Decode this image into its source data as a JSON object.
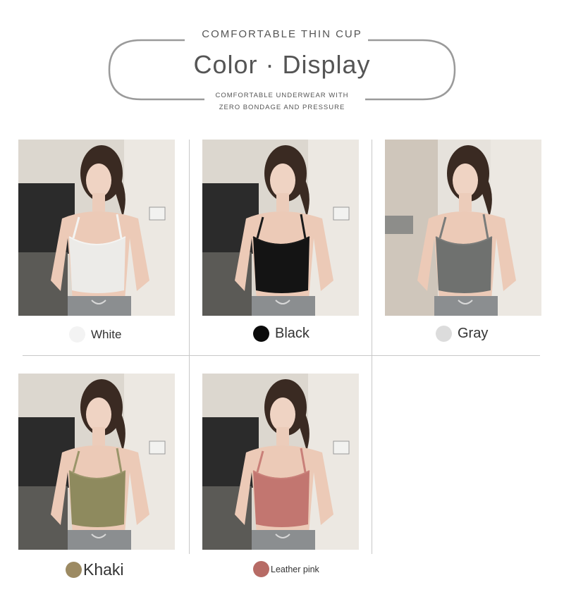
{
  "header": {
    "eyebrow": "COMFORTABLE THIN CUP",
    "title": "Color · Display",
    "subtitle_line1": "COMFORTABLE UNDERWEAR WITH",
    "subtitle_line2": "ZERO BONDAGE AND PRESSURE"
  },
  "colors": [
    {
      "label": "White",
      "swatch_hex": "#f3f3f3",
      "top_hex": "#ecebe8",
      "strap_hex": "#f4f4f2"
    },
    {
      "label": "Black",
      "swatch_hex": "#0b0b0b",
      "top_hex": "#141414",
      "strap_hex": "#1a1a1a"
    },
    {
      "label": "Gray",
      "swatch_hex": "#dcdcdc",
      "top_hex": "#6f716f",
      "strap_hex": "#7a7c7a"
    },
    {
      "label": "Khaki",
      "swatch_hex": "#9c8a62",
      "top_hex": "#8e8a5e",
      "strap_hex": "#9a956a"
    },
    {
      "label": "Leather pink",
      "swatch_hex": "#b76b65",
      "top_hex": "#c27670",
      "strap_hex": "#c98079"
    }
  ]
}
